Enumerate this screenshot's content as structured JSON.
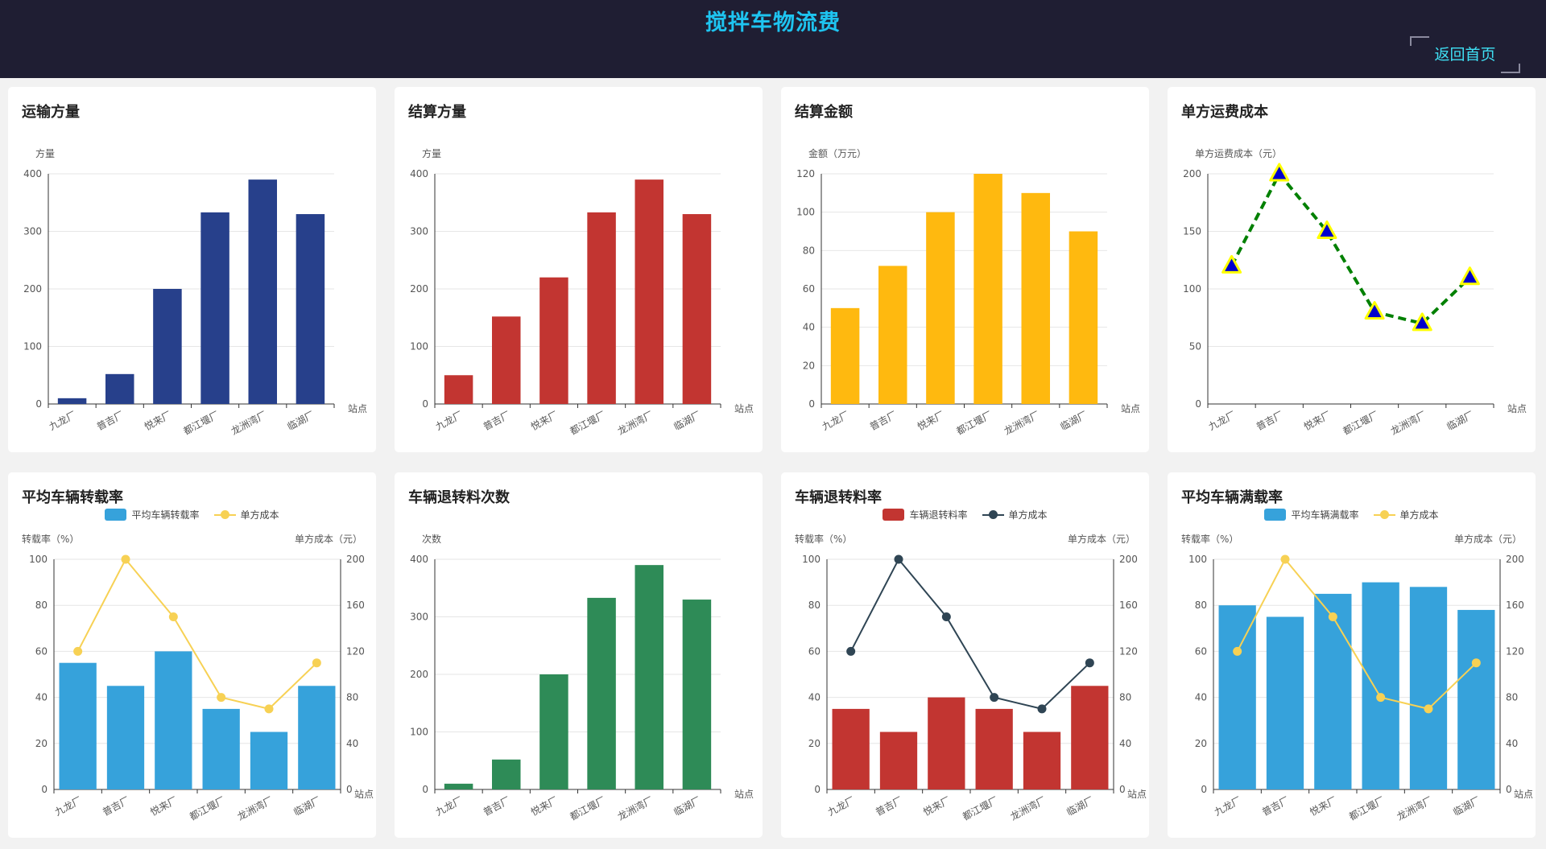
{
  "header": {
    "title": "搅拌车物流费",
    "back_label": "返回首页"
  },
  "colors": {
    "navy": "#27408b",
    "red": "#c23531",
    "yellow": "#ffb90f",
    "green": "#2e8b57",
    "blue": "#36a2db",
    "gold": "#f7d154",
    "slate": "#2f4554"
  },
  "charts": [
    {
      "title": "运输方量",
      "chart_data": {
        "type": "bar",
        "categories": [
          "九龙厂",
          "普吉厂",
          "悦来厂",
          "都江堰厂",
          "龙洲湾厂",
          "临湖厂"
        ],
        "ylabel": "方量",
        "xlabel": "站点",
        "ylim": [
          0,
          400
        ],
        "yticks": [
          0,
          100,
          200,
          300,
          400
        ],
        "series": [
          {
            "kind": "bar",
            "color": "#27408b",
            "values": [
              10,
              52,
              200,
              333,
              390,
              330
            ]
          }
        ]
      }
    },
    {
      "title": "结算方量",
      "chart_data": {
        "type": "bar",
        "categories": [
          "九龙厂",
          "普吉厂",
          "悦来厂",
          "都江堰厂",
          "龙洲湾厂",
          "临湖厂"
        ],
        "ylabel": "方量",
        "xlabel": "站点",
        "ylim": [
          0,
          400
        ],
        "yticks": [
          0,
          100,
          200,
          300,
          400
        ],
        "series": [
          {
            "kind": "bar",
            "color": "#c23531",
            "values": [
              50,
              152,
              220,
              333,
              390,
              330
            ]
          }
        ]
      }
    },
    {
      "title": "结算金额",
      "chart_data": {
        "type": "bar",
        "categories": [
          "九龙厂",
          "普吉厂",
          "悦来厂",
          "都江堰厂",
          "龙洲湾厂",
          "临湖厂"
        ],
        "ylabel": "金额（万元）",
        "xlabel": "站点",
        "ylim": [
          0,
          120
        ],
        "yticks": [
          0,
          20,
          40,
          60,
          80,
          100,
          120
        ],
        "series": [
          {
            "kind": "bar",
            "color": "#ffb90f",
            "values": [
              50,
              72,
              100,
              120,
              110,
              90
            ]
          }
        ]
      }
    },
    {
      "title": "单方运费成本",
      "chart_data": {
        "type": "line",
        "categories": [
          "九龙厂",
          "普吉厂",
          "悦来厂",
          "都江堰厂",
          "龙洲湾厂",
          "临湖厂"
        ],
        "ylabel": "单方运费成本（元）",
        "xlabel": "站点",
        "ylim": [
          0,
          200
        ],
        "yticks": [
          0,
          50,
          100,
          150,
          200
        ],
        "series": [
          {
            "kind": "line",
            "style": "dashed-triangle",
            "color": "#008000",
            "marker_fill": "#0000cd",
            "marker_stroke": "#ffff00",
            "values": [
              120,
              200,
              150,
              80,
              70,
              110
            ]
          }
        ]
      }
    },
    {
      "title": "平均车辆转载率",
      "chart_data": {
        "type": "bar",
        "categories": [
          "九龙厂",
          "普吉厂",
          "悦来厂",
          "都江堰厂",
          "龙洲湾厂",
          "临湖厂"
        ],
        "ylabel": "转载率（%）",
        "y2label": "单方成本（元）",
        "xlabel": "站点",
        "ylim": [
          0,
          100
        ],
        "yticks": [
          0,
          20,
          40,
          60,
          80,
          100
        ],
        "y2lim": [
          0,
          200
        ],
        "y2ticks": [
          0,
          40,
          80,
          120,
          160,
          200
        ],
        "series": [
          {
            "name": "平均车辆转载率",
            "kind": "bar",
            "color": "#36a2db",
            "values": [
              55,
              45,
              60,
              35,
              25,
              45
            ]
          },
          {
            "name": "单方成本",
            "kind": "line",
            "axis": "right",
            "color": "#f7d154",
            "values": [
              120,
              200,
              150,
              80,
              70,
              110
            ]
          }
        ]
      }
    },
    {
      "title": "车辆退转料次数",
      "chart_data": {
        "type": "bar",
        "categories": [
          "九龙厂",
          "普吉厂",
          "悦来厂",
          "都江堰厂",
          "龙洲湾厂",
          "临湖厂"
        ],
        "ylabel": "次数",
        "xlabel": "站点",
        "ylim": [
          0,
          400
        ],
        "yticks": [
          0,
          100,
          200,
          300,
          400
        ],
        "series": [
          {
            "kind": "bar",
            "color": "#2e8b57",
            "values": [
              10,
              52,
              200,
              333,
              390,
              330
            ]
          }
        ]
      }
    },
    {
      "title": "车辆退转料率",
      "chart_data": {
        "type": "bar",
        "categories": [
          "九龙厂",
          "普吉厂",
          "悦来厂",
          "都江堰厂",
          "龙洲湾厂",
          "临湖厂"
        ],
        "ylabel": "转载率（%）",
        "y2label": "单方成本（元）",
        "xlabel": "站点",
        "ylim": [
          0,
          100
        ],
        "yticks": [
          0,
          20,
          40,
          60,
          80,
          100
        ],
        "y2lim": [
          0,
          200
        ],
        "y2ticks": [
          0,
          40,
          80,
          120,
          160,
          200
        ],
        "series": [
          {
            "name": "车辆退转料率",
            "kind": "bar",
            "color": "#c23531",
            "values": [
              35,
              25,
              40,
              35,
              25,
              45
            ]
          },
          {
            "name": "单方成本",
            "kind": "line",
            "axis": "right",
            "color": "#2f4554",
            "values": [
              120,
              200,
              150,
              80,
              70,
              110
            ]
          }
        ]
      }
    },
    {
      "title": "平均车辆满载率",
      "chart_data": {
        "type": "bar",
        "categories": [
          "九龙厂",
          "普吉厂",
          "悦来厂",
          "都江堰厂",
          "龙洲湾厂",
          "临湖厂"
        ],
        "ylabel": "转载率（%）",
        "y2label": "单方成本（元）",
        "xlabel": "站点",
        "ylim": [
          0,
          100
        ],
        "yticks": [
          0,
          20,
          40,
          60,
          80,
          100
        ],
        "y2lim": [
          0,
          200
        ],
        "y2ticks": [
          0,
          40,
          80,
          120,
          160,
          200
        ],
        "series": [
          {
            "name": "平均车辆满载率",
            "kind": "bar",
            "color": "#36a2db",
            "values": [
              80,
              75,
              85,
              90,
              88,
              78
            ]
          },
          {
            "name": "单方成本",
            "kind": "line",
            "axis": "right",
            "color": "#f7d154",
            "values": [
              120,
              200,
              150,
              80,
              70,
              110
            ]
          }
        ]
      }
    }
  ]
}
